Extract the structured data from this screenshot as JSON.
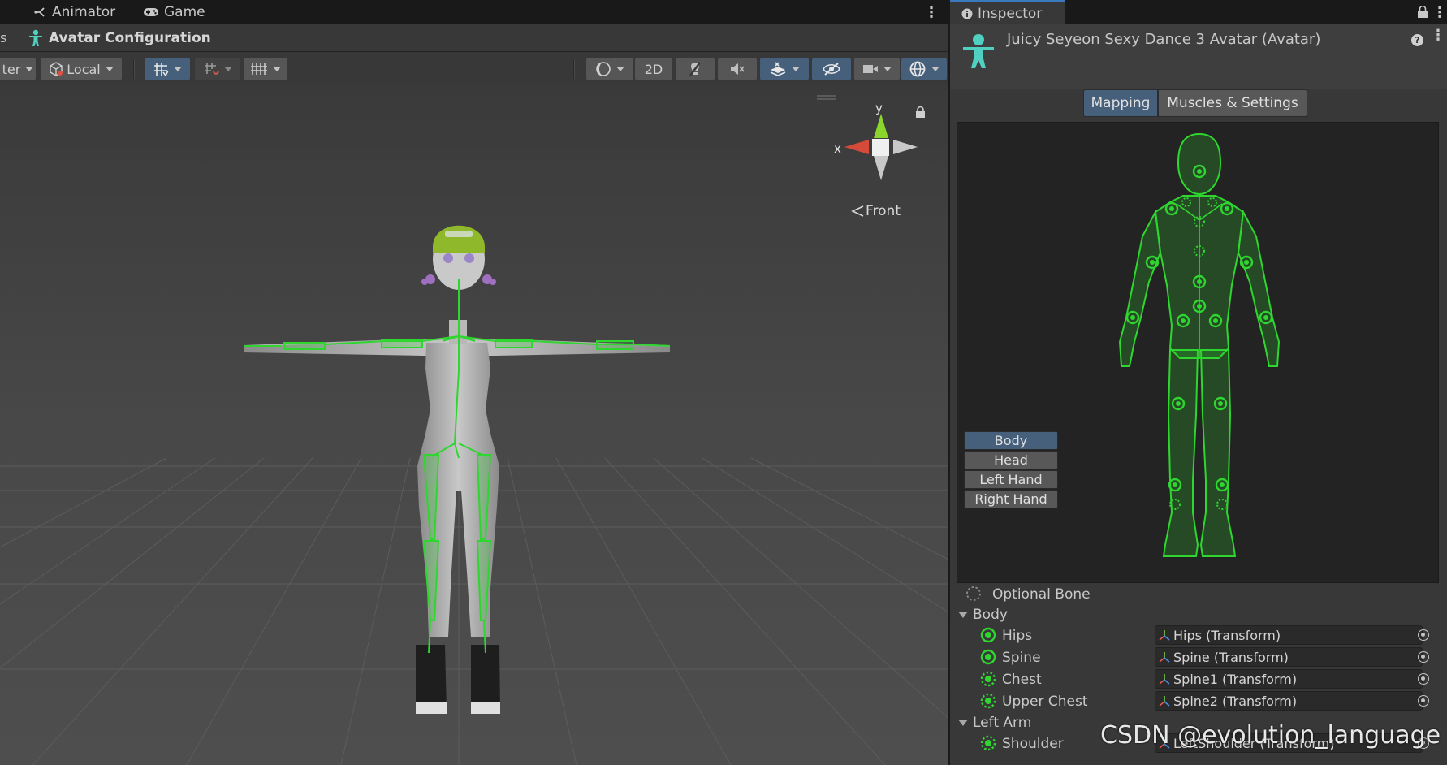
{
  "scene_tabs": {
    "animator": "Animator",
    "game": "Game"
  },
  "breadcrumb": {
    "previous_fragment": "s",
    "current": "Avatar Configuration"
  },
  "toolbar": {
    "pivot_fragment": "ter",
    "local": "Local",
    "mode_2d": "2D"
  },
  "gizmo": {
    "y": "y",
    "x": "x",
    "front": "Front"
  },
  "inspector": {
    "tab": "Inspector",
    "title": "Juicy Seyeon Sexy Dance 3 Avatar (Avatar)",
    "help": "?",
    "mapping_tab": "Mapping",
    "muscles_tab": "Muscles & Settings"
  },
  "parts": {
    "body": "Body",
    "head": "Head",
    "left_hand": "Left Hand",
    "right_hand": "Right Hand"
  },
  "legend": {
    "optional_bone": "Optional Bone"
  },
  "sections": {
    "body": "Body",
    "left_arm": "Left Arm"
  },
  "bones": [
    {
      "label": "Hips",
      "value": "Hips (Transform)",
      "optional": false
    },
    {
      "label": "Spine",
      "value": "Spine (Transform)",
      "optional": false
    },
    {
      "label": "Chest",
      "value": "Spine1 (Transform)",
      "optional": true
    },
    {
      "label": "Upper Chest",
      "value": "Spine2 (Transform)",
      "optional": true
    }
  ],
  "left_arm_bones": [
    {
      "label": "Shoulder",
      "value": "LeftShoulder (Transform)",
      "optional": true
    }
  ],
  "watermark": "CSDN @evolution_language",
  "colors": {
    "accent_blue": "#46607c",
    "bone_green": "#2fd62f",
    "avatar_teal": "#4fd0c0"
  }
}
